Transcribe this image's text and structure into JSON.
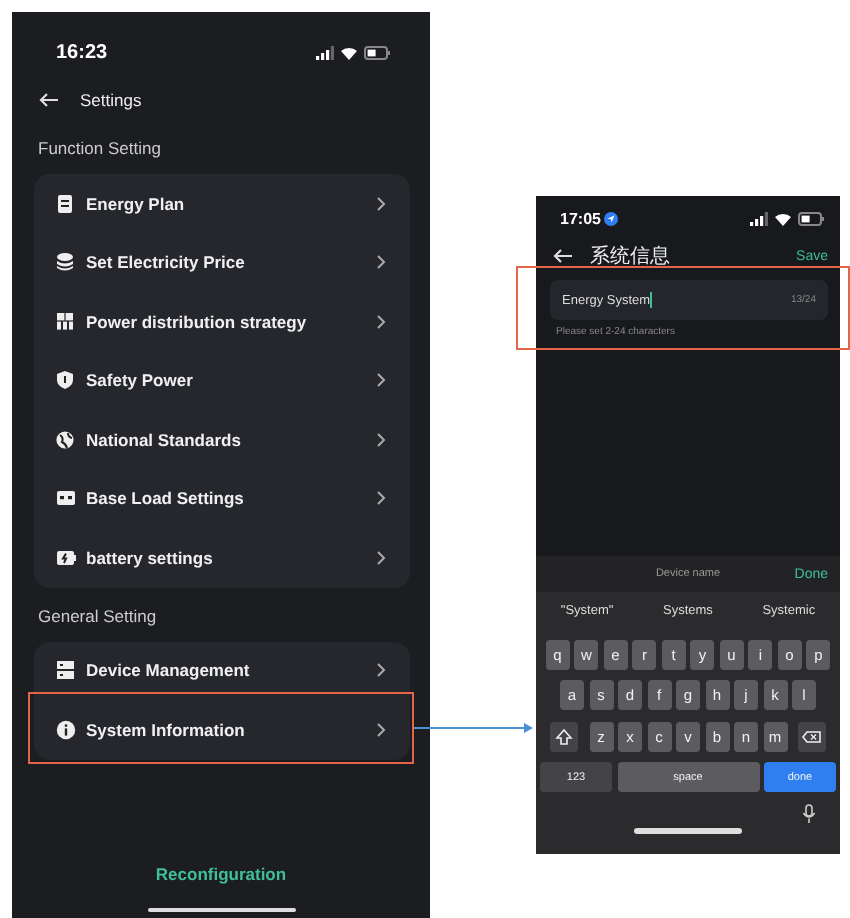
{
  "settings_screen": {
    "status_bar": {
      "time": "16:23"
    },
    "title": "Settings",
    "sections": [
      {
        "title": "Function Setting",
        "items": [
          {
            "label": "Energy Plan",
            "highlighted": false
          },
          {
            "label": "Set Electricity Price",
            "highlighted": false
          },
          {
            "label": "Power distribution strategy",
            "highlighted": false
          },
          {
            "label": "Safety Power",
            "highlighted": false
          },
          {
            "label": "National Standards",
            "highlighted": false
          },
          {
            "label": "Base Load Settings",
            "highlighted": false
          },
          {
            "label": "battery settings",
            "highlighted": false
          }
        ]
      },
      {
        "title": "General Setting",
        "items": [
          {
            "label": "Device Management",
            "highlighted": false
          },
          {
            "label": "System Information",
            "highlighted": true
          }
        ]
      }
    ],
    "action": "Reconfiguration"
  },
  "system_info_screen": {
    "status_bar": {
      "time": "17:05"
    },
    "title": "系统信息",
    "save": "Save",
    "name_field": {
      "value": "Energy System",
      "counter": "13/24",
      "hint": "Please set 2-24 characters",
      "highlighted": true
    },
    "keyboard": {
      "toolbar_title": "Device name",
      "done": "Done",
      "suggestions": [
        "\"System\"",
        "Systems",
        "Systemic"
      ],
      "rows": [
        {
          "keys": [
            "q",
            "w",
            "e",
            "r",
            "t",
            "y",
            "u",
            "i",
            "o",
            "p"
          ],
          "modifiers": false
        },
        {
          "keys": [
            "a",
            "s",
            "d",
            "f",
            "g",
            "h",
            "j",
            "k",
            "l"
          ],
          "modifiers": false
        },
        {
          "keys": [
            "z",
            "x",
            "c",
            "v",
            "b",
            "n",
            "m"
          ],
          "modifiers": true
        }
      ],
      "numbers": "123",
      "space": "space",
      "return": "done"
    }
  }
}
